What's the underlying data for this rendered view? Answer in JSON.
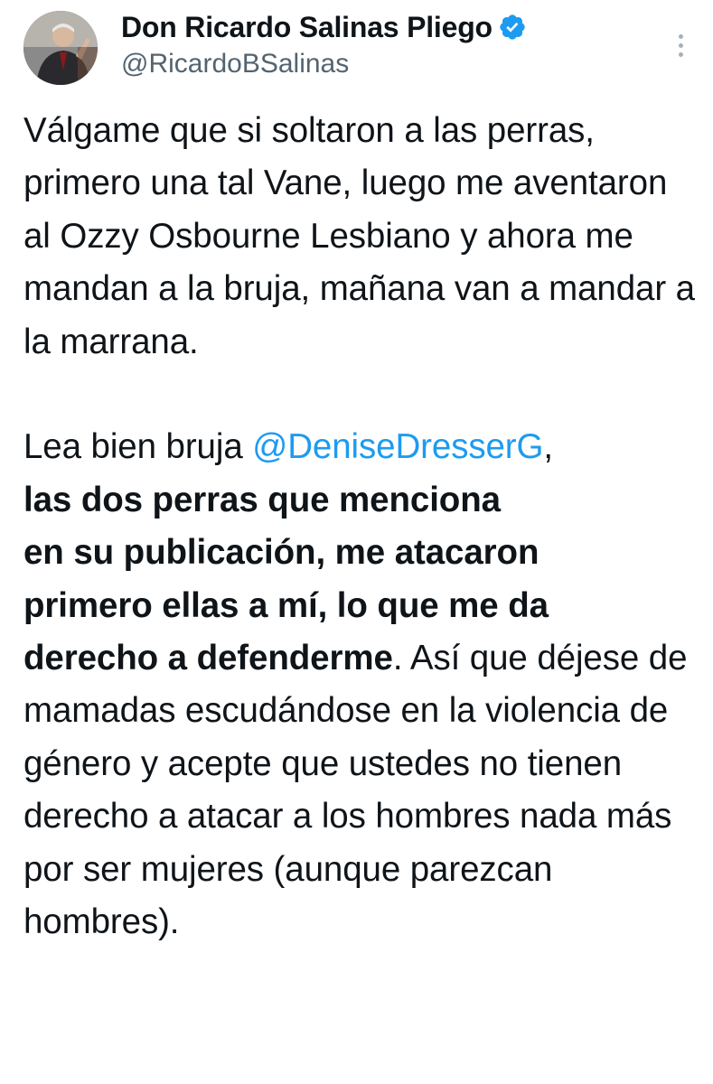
{
  "author": {
    "display_name": "Don Ricardo Salinas Pliego",
    "handle": "@RicardoBSalinas",
    "verified": true,
    "verified_color": "#1d9bf0"
  },
  "tweet": {
    "paragraph1": "Válgame que si soltaron a las perras, primero una tal Vane, luego me aventaron al Ozzy Osbourne Lesbiano y ahora me mandan a la bruja, mañana van a mandar a la marrana.",
    "p2_intro": "Lea bien bruja ",
    "mention": "@DeniseDresserG",
    "p2_comma": ",",
    "p2_bold_line1": "las dos perras que menciona",
    "p2_bold_line2": "en su publicación, me atacaron",
    "p2_bold_line3": "primero ellas a mí, lo que me da",
    "p2_bold_line4": "derecho a defenderme",
    "p2_rest": ". Así que déjese de mamadas escudándose en la violencia de género y acepte que ustedes no tienen derecho a atacar a los hombres nada más por ser mujeres (aunque parezcan hombres)."
  },
  "colors": {
    "text": "#0f1419",
    "secondary": "#536471",
    "link": "#1d9bf0"
  },
  "icons": {
    "verified": "verified-badge-icon",
    "more": "more-vertical-icon"
  }
}
